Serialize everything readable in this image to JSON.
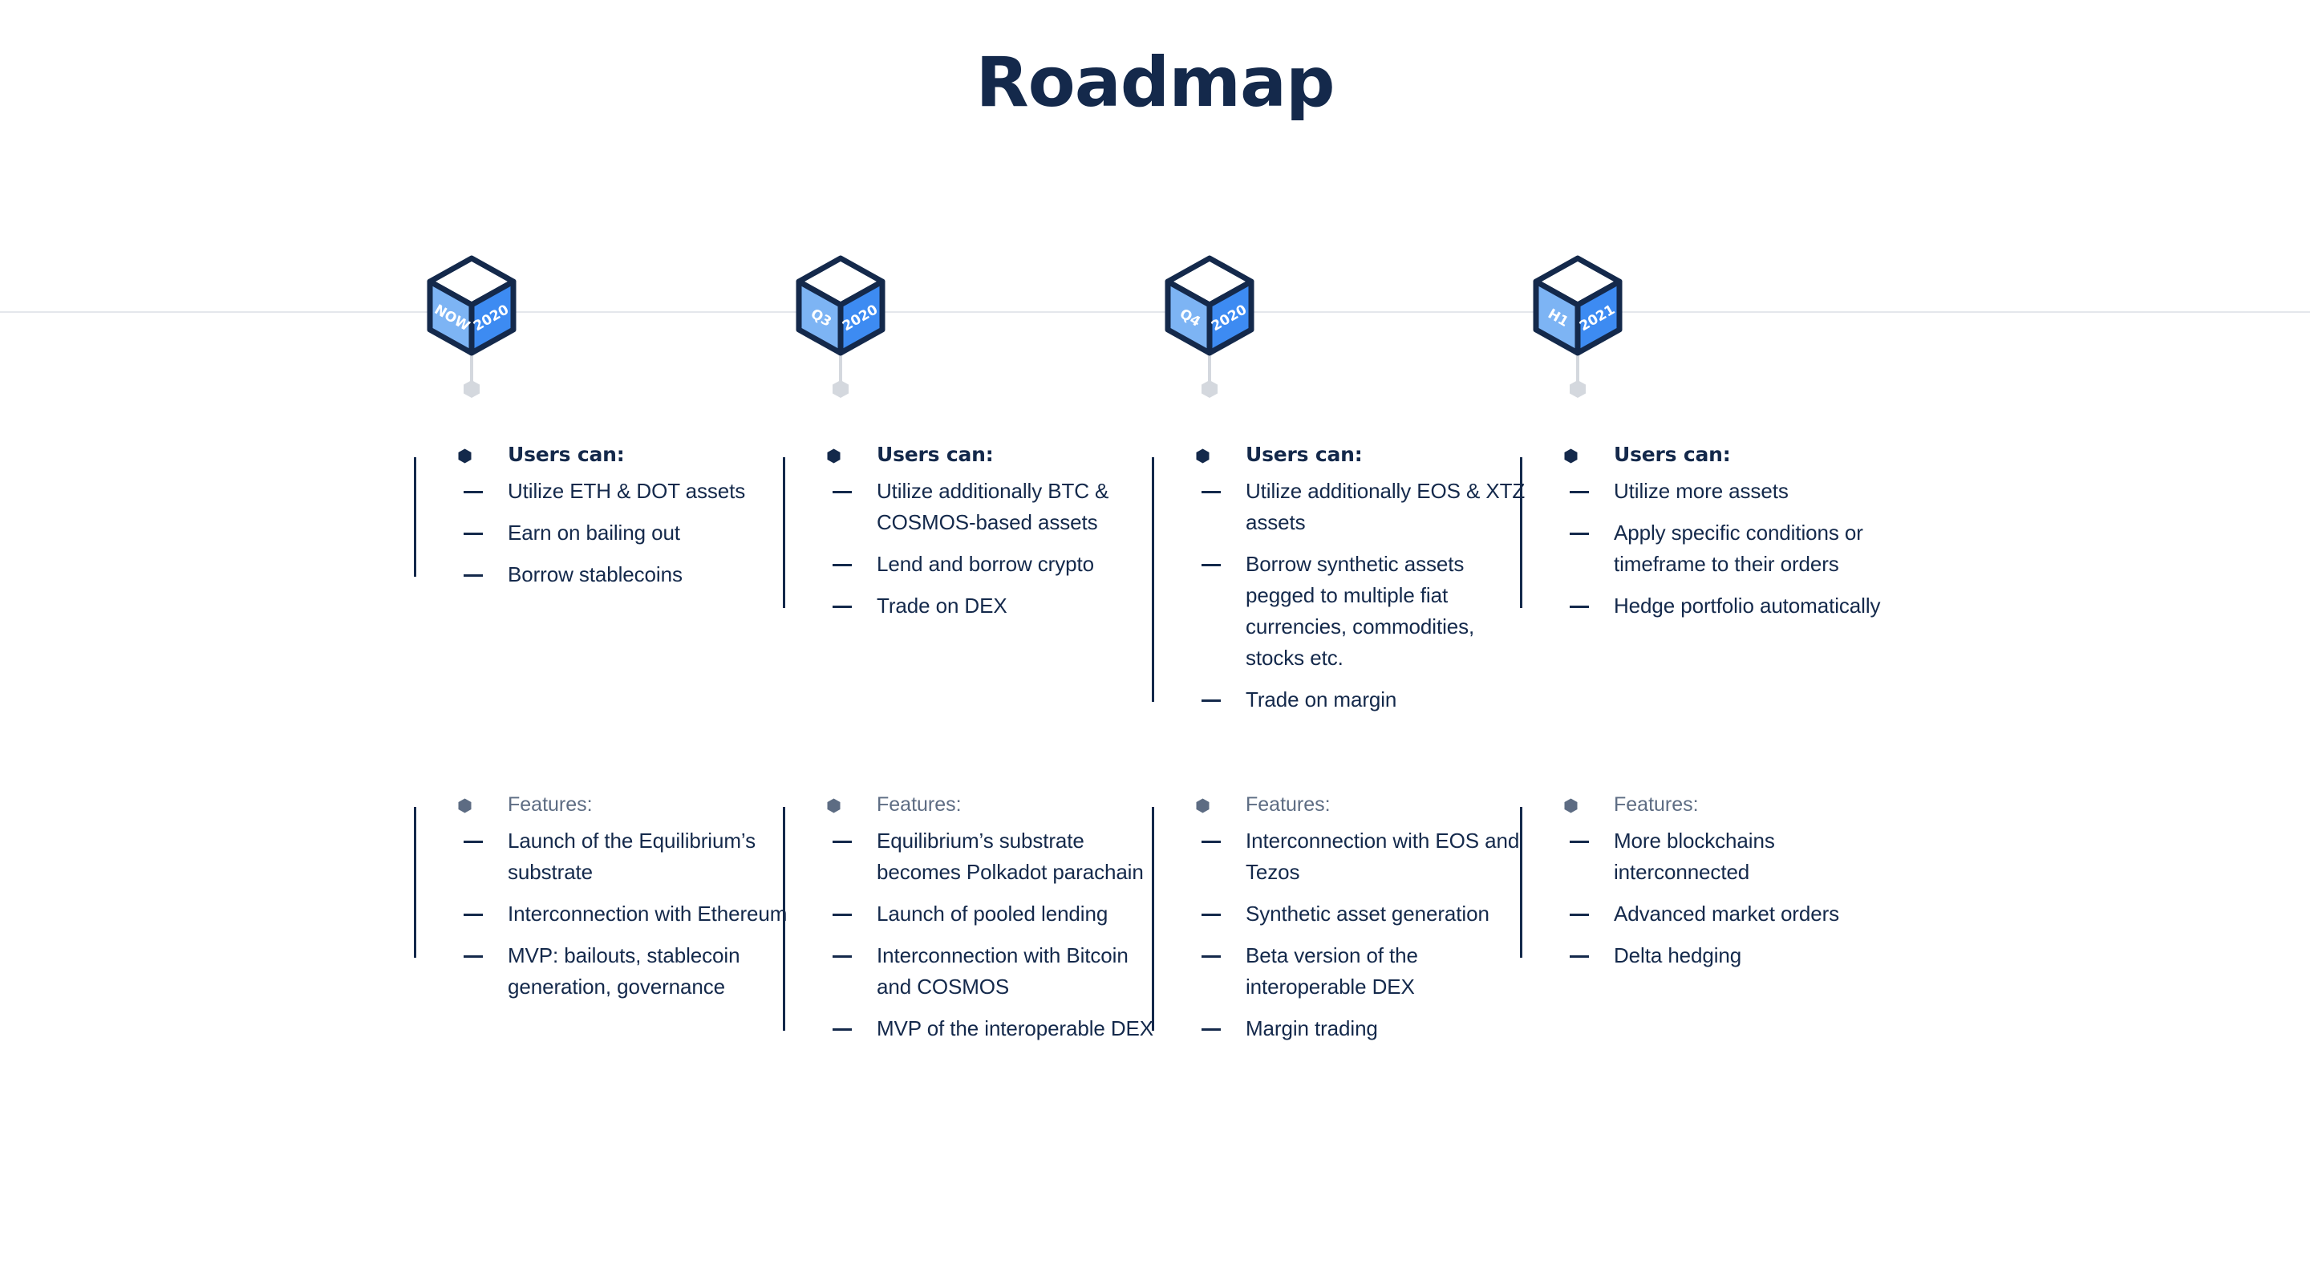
{
  "page": {
    "title": "Roadmap",
    "colors": {
      "navy": "#14294b",
      "gray_text": "#5d6c83",
      "cube_left": "#7db4f4",
      "cube_right": "#3d8bf2",
      "cube_top": "#ffffff",
      "rule": "#e4e7ec",
      "pin": "#d4d8de"
    }
  },
  "timeline": {
    "milestones": [
      {
        "id": "now-2020",
        "period": "NOW",
        "year": "2020"
      },
      {
        "id": "q3-2020",
        "period": "Q3",
        "year": "2020"
      },
      {
        "id": "q4-2020",
        "period": "Q4",
        "year": "2020"
      },
      {
        "id": "h1-2021",
        "period": "H1",
        "year": "2021"
      }
    ]
  },
  "columns": [
    {
      "users": {
        "heading": "Users can:",
        "items": [
          "Utilize ETH & DOT assets",
          "Earn on bailing out",
          "Borrow stablecoins"
        ]
      },
      "features": {
        "heading": "Features:",
        "items": [
          "Launch of the Equilibrium’s substrate",
          "Interconnection with Ethereum",
          "MVP: bailouts, stablecoin generation, governance"
        ]
      }
    },
    {
      "users": {
        "heading": "Users can:",
        "items": [
          "Utilize additionally BTC & COSMOS-based assets",
          "Lend and borrow crypto",
          "Trade on DEX"
        ]
      },
      "features": {
        "heading": "Features:",
        "items": [
          "Equilibrium’s substrate becomes Polkadot parachain",
          "Launch of pooled lending",
          "Interconnection with Bitcoin and COSMOS",
          "MVP of the interoperable DEX"
        ]
      }
    },
    {
      "users": {
        "heading": "Users can:",
        "items": [
          "Utilize additionally EOS & XTZ assets",
          "Borrow synthetic assets pegged to multiple fiat currencies, commodities, stocks etc.",
          "Trade on margin"
        ]
      },
      "features": {
        "heading": "Features:",
        "items": [
          "Interconnection with EOS and Tezos",
          "Synthetic asset generation",
          "Beta version of the interoperable DEX",
          "Margin trading"
        ]
      }
    },
    {
      "users": {
        "heading": "Users can:",
        "items": [
          "Utilize more assets",
          "Apply specific conditions or timeframe to their orders",
          "Hedge portfolio automatically"
        ]
      },
      "features": {
        "heading": "Features:",
        "items": [
          "More blockchains interconnected",
          "Advanced market orders",
          "Delta hedging"
        ]
      }
    }
  ]
}
